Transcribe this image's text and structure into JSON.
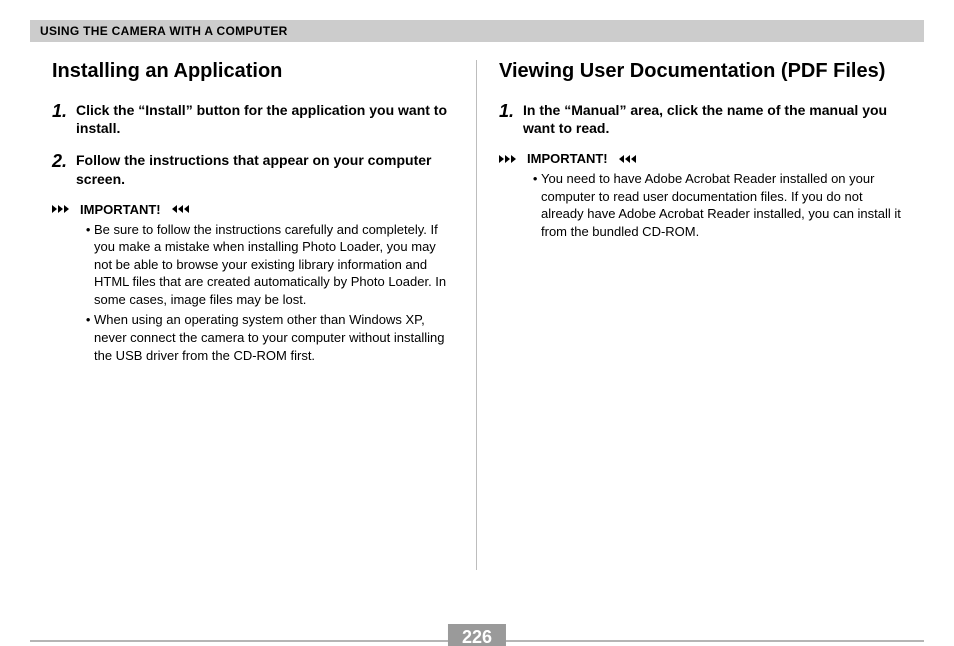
{
  "chapter_title": "USING THE CAMERA WITH A COMPUTER",
  "page_number": "226",
  "left": {
    "section_title": "Installing an Application",
    "steps": [
      {
        "num": "1",
        "text": "Click the “Install” button for the application you want to install."
      },
      {
        "num": "2",
        "text": "Follow the instructions that appear on your computer screen."
      }
    ],
    "important_label": "IMPORTANT!",
    "important_items": [
      "Be sure to follow the instructions carefully and completely. If you make a mistake when installing Photo Loader, you may not be able to browse your existing library information and HTML files that are created automatically by Photo Loader. In some cases, image files may be lost.",
      "When using an operating system other than Windows XP, never connect the camera to your computer without installing the USB driver from the CD-ROM first."
    ]
  },
  "right": {
    "section_title": "Viewing User Documentation (PDF Files)",
    "steps": [
      {
        "num": "1",
        "text": "In the “Manual” area, click the name of the manual you want to read."
      }
    ],
    "important_label": "IMPORTANT!",
    "important_items": [
      "You need to have Adobe Acrobat Reader installed on your computer to read user documentation files. If you do not already have Adobe Acrobat Reader installed, you can install it from the bundled CD-ROM."
    ]
  }
}
